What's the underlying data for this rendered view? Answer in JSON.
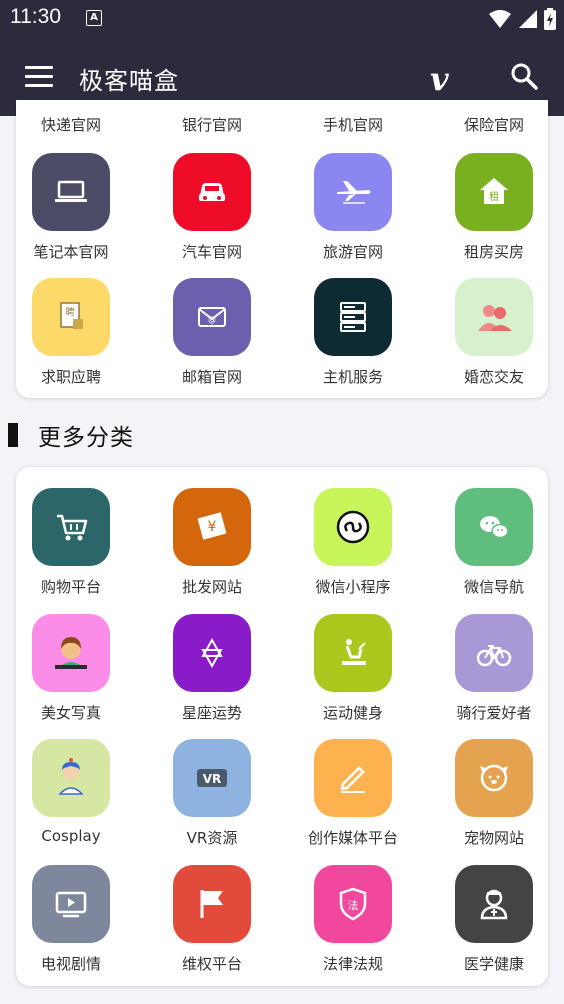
{
  "status": {
    "time": "11:30"
  },
  "appbar": {
    "title": "极客喵盒",
    "vimeo_glyph": "v"
  },
  "section1": {
    "top_labels": [
      "快递官网",
      "银行官网",
      "手机官网",
      "保险官网"
    ],
    "rows": [
      [
        {
          "label": "笔记本官网",
          "color": "#4d4c66",
          "icon": "laptop-icon"
        },
        {
          "label": "汽车官网",
          "color": "#ee0c28",
          "icon": "car-icon"
        },
        {
          "label": "旅游官网",
          "color": "#8b86f0",
          "icon": "airplane-icon"
        },
        {
          "label": "租房买房",
          "color": "#7ab01f",
          "icon": "house-rent-icon"
        }
      ],
      [
        {
          "label": "求职应聘",
          "color": "#fdd96a",
          "icon": "resume-icon"
        },
        {
          "label": "邮箱官网",
          "color": "#6b5fae",
          "icon": "mail-icon"
        },
        {
          "label": "主机服务",
          "color": "#0e2a33",
          "icon": "server-icon"
        },
        {
          "label": "婚恋交友",
          "color": "#d7f1cc",
          "icon": "couple-icon"
        }
      ]
    ]
  },
  "section2": {
    "heading": "更多分类",
    "rows": [
      [
        {
          "label": "购物平台",
          "color": "#2c6668",
          "icon": "shopping-cart-icon"
        },
        {
          "label": "批发网站",
          "color": "#d4660c",
          "icon": "wholesale-icon"
        },
        {
          "label": "微信小程序",
          "color": "#c8f55a",
          "icon": "mini-program-icon"
        },
        {
          "label": "微信导航",
          "color": "#5fbd7e",
          "icon": "wechat-icon"
        }
      ],
      [
        {
          "label": "美女写真",
          "color": "#fb8ce7",
          "icon": "girl-portrait-icon"
        },
        {
          "label": "星座运势",
          "color": "#8a1bc9",
          "icon": "star-of-david-icon"
        },
        {
          "label": "运动健身",
          "color": "#a9c71d",
          "icon": "fitness-icon"
        },
        {
          "label": "骑行爱好者",
          "color": "#a998d6",
          "icon": "bicycle-icon"
        }
      ],
      [
        {
          "label": "Cosplay",
          "color": "#d6e6a3",
          "icon": "cosplay-icon"
        },
        {
          "label": "VR资源",
          "color": "#8fb3e0",
          "icon": "vr-icon"
        },
        {
          "label": "创作媒体平台",
          "color": "#fdb24f",
          "icon": "pen-icon"
        },
        {
          "label": "宠物网站",
          "color": "#e5a24f",
          "icon": "pet-dog-icon"
        }
      ],
      [
        {
          "label": "电视剧情",
          "color": "#7e879c",
          "icon": "tv-icon"
        },
        {
          "label": "维权平台",
          "color": "#e24a3b",
          "icon": "flag-icon"
        },
        {
          "label": "法律法规",
          "color": "#f1479d",
          "icon": "law-shield-icon"
        },
        {
          "label": "医学健康",
          "color": "#454444",
          "icon": "doctor-icon"
        }
      ]
    ]
  }
}
